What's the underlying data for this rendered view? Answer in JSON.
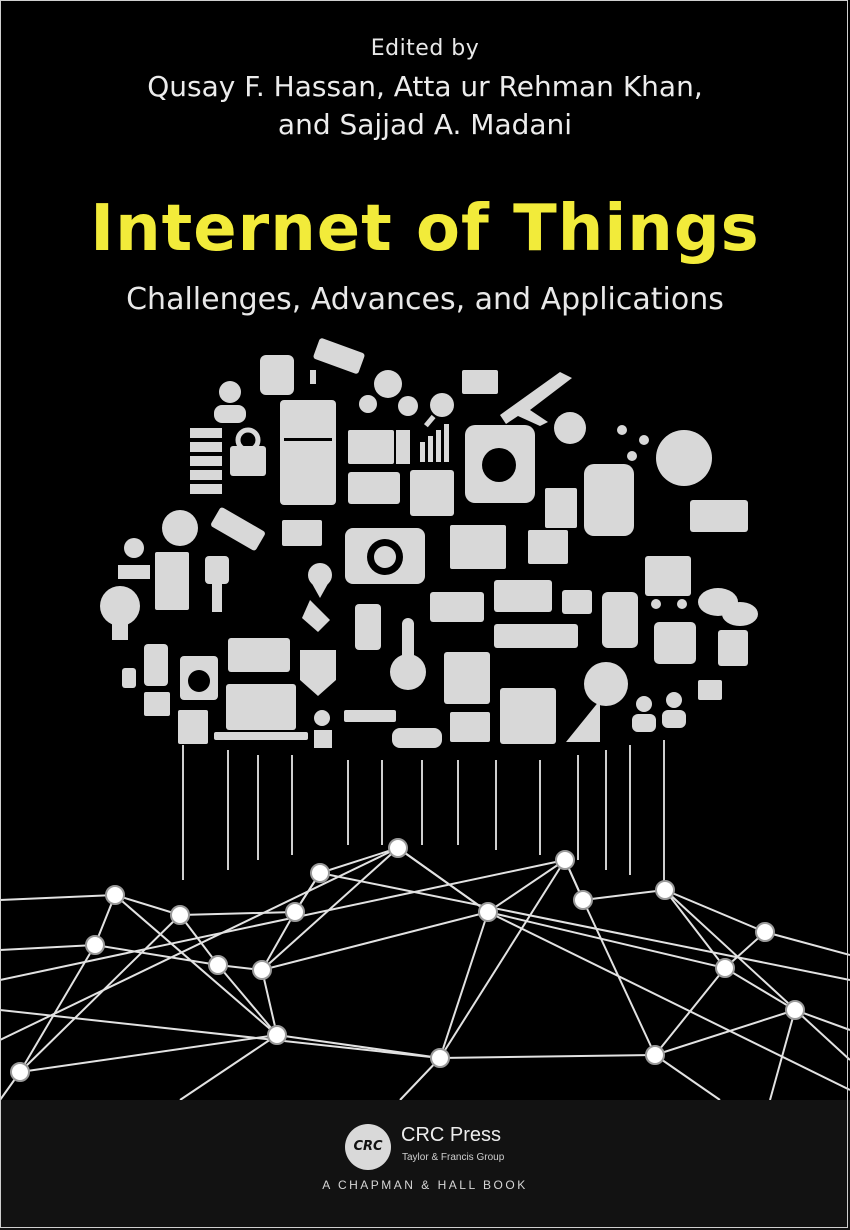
{
  "cover": {
    "editors_label": "Edited by",
    "authors_line1": "Qusay F. Hassan, Atta ur Rehman Khan,",
    "authors_line2": "and Sajjad A. Madani",
    "title": "Internet of Things",
    "subtitle": "Challenges, Advances, and Applications"
  },
  "publisher": {
    "logo_text": "CRC",
    "name": "CRC Press",
    "group": "Taylor & Francis Group",
    "imprint": "A CHAPMAN & HALL BOOK"
  },
  "colors": {
    "background": "#000000",
    "title": "#f2eb3a",
    "icons": "#d8d8d8",
    "network": "#e6e6e6"
  },
  "icons": [
    "database-icon",
    "cctv-camera-icon",
    "gears-icon",
    "envelope-icon",
    "airplane-icon",
    "user-icon",
    "magnifier-icon",
    "server-icon",
    "lock-icon",
    "refrigerator-icon",
    "computer-icon",
    "bar-chart-icon",
    "stand-mixer-icon",
    "snowflake-icon",
    "network-graph-icon",
    "satellite-dish-icon",
    "monitor-icon",
    "layers-icon",
    "smartwatch-icon",
    "globe-icon",
    "satellite-icon",
    "camera-icon",
    "growth-chart-icon",
    "video-player-icon",
    "map-pin-icon",
    "door-icon",
    "plug-icon",
    "location-icon",
    "robot-arm-icon",
    "delivery-truck-icon",
    "faucet-icon",
    "tablet-icon",
    "shopping-cart-icon",
    "chat-bubbles-icon",
    "light-bulb-icon",
    "rocket-icon",
    "phone-icon",
    "thermometer-icon",
    "ship-icon",
    "rss-icon",
    "star-book-icon",
    "music-note-icon",
    "smartphone-icon",
    "washing-machine-icon",
    "shield-check-icon",
    "router-icon",
    "car-icon",
    "laptop-icon",
    "flower-pot-icon",
    "coffee-machine-icon",
    "alarm-clock-icon",
    "people-icon",
    "cpu-icon",
    "film-icon"
  ]
}
